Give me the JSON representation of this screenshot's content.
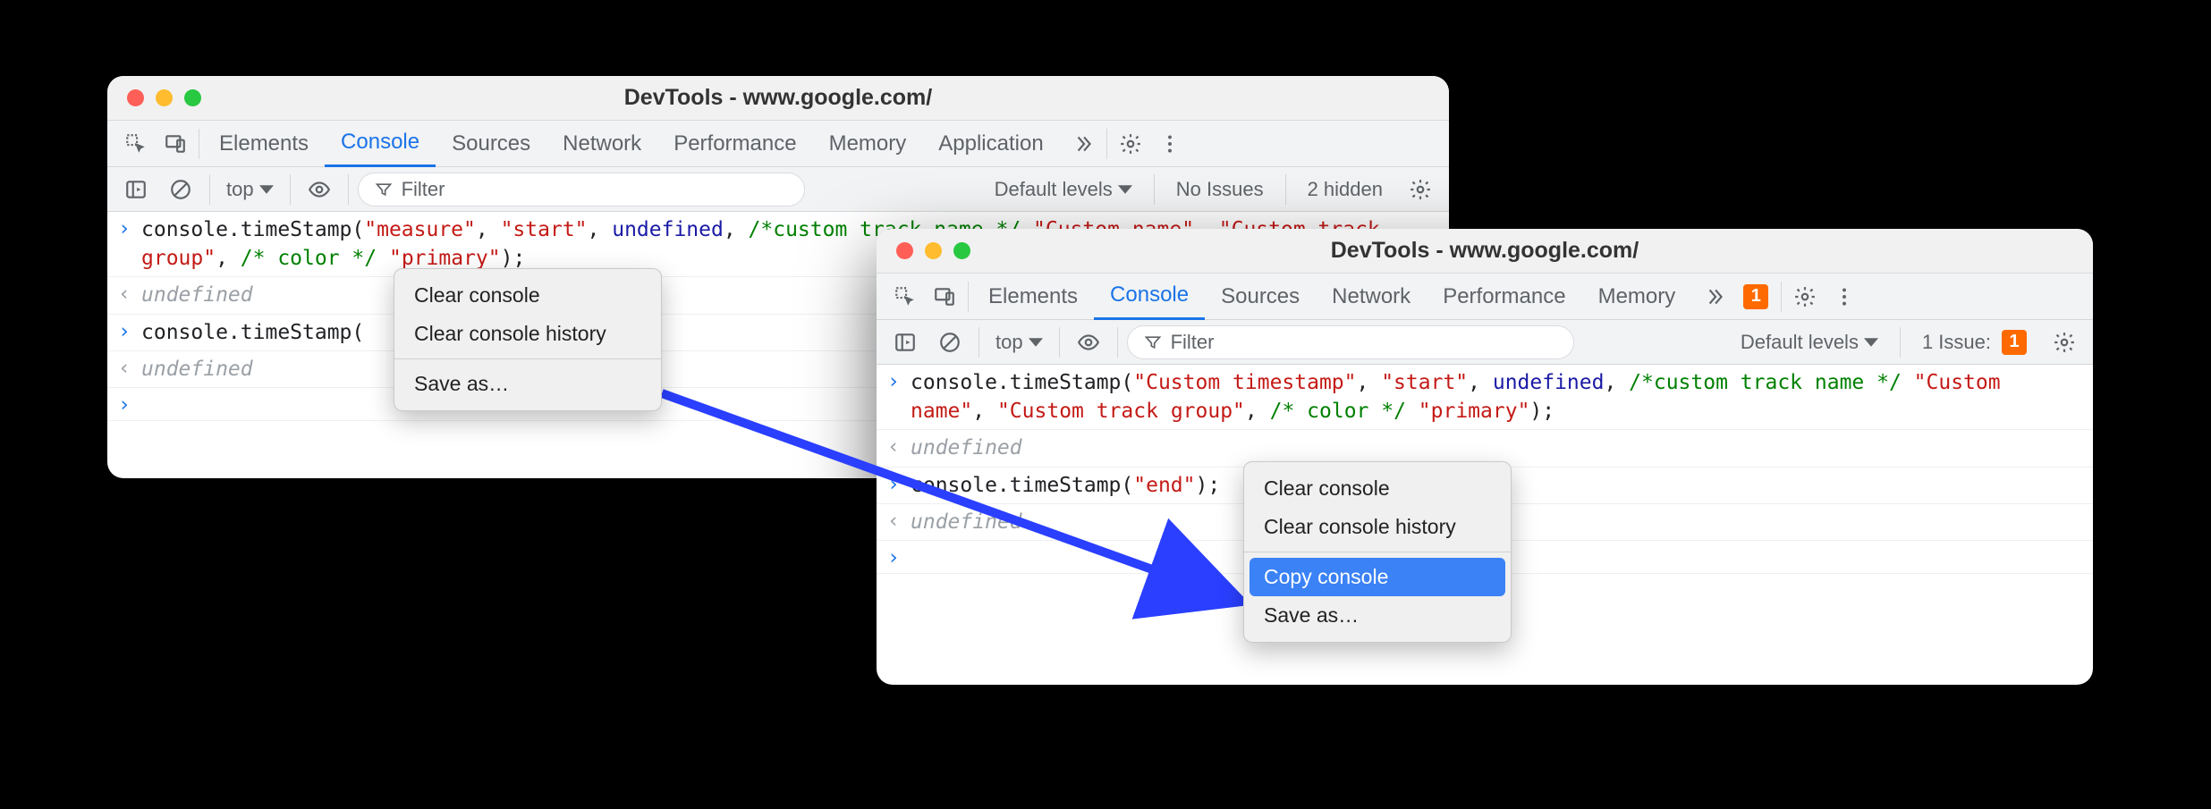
{
  "left": {
    "title": "DevTools - www.google.com/",
    "tabs": [
      "Elements",
      "Console",
      "Sources",
      "Network",
      "Performance",
      "Memory",
      "Application"
    ],
    "active_tab": "Console",
    "filter": {
      "context": "top",
      "placeholder": "Filter",
      "levels": "Default levels",
      "issues": "No Issues",
      "hidden": "2 hidden"
    },
    "console": [
      {
        "type": "input",
        "segments": [
          {
            "t": "fn",
            "v": "console.timeStamp("
          },
          {
            "t": "str",
            "v": "\"measure\""
          },
          {
            "t": "fn",
            "v": ", "
          },
          {
            "t": "str",
            "v": "\"start\""
          },
          {
            "t": "fn",
            "v": ", "
          },
          {
            "t": "kw",
            "v": "undefined"
          },
          {
            "t": "fn",
            "v": ", "
          },
          {
            "t": "cmt",
            "v": "/*custom track name */"
          },
          {
            "t": "fn",
            "v": " "
          },
          {
            "t": "str",
            "v": "\"Custom name\""
          },
          {
            "t": "fn",
            "v": ", "
          },
          {
            "t": "str",
            "v": "\"Custom track group\""
          },
          {
            "t": "fn",
            "v": ", "
          },
          {
            "t": "cmt",
            "v": "/* color */"
          },
          {
            "t": "fn",
            "v": " "
          },
          {
            "t": "str",
            "v": "\"primary\""
          },
          {
            "t": "fn",
            "v": ");"
          }
        ]
      },
      {
        "type": "output",
        "text": "undefined"
      },
      {
        "type": "input",
        "segments": [
          {
            "t": "fn",
            "v": "console.timeStamp("
          }
        ]
      },
      {
        "type": "output",
        "text": "undefined"
      },
      {
        "type": "prompt"
      }
    ],
    "menu": {
      "items": [
        "Clear console",
        "Clear console history"
      ],
      "after_sep": [
        "Save as…"
      ]
    }
  },
  "right": {
    "title": "DevTools - www.google.com/",
    "tabs": [
      "Elements",
      "Console",
      "Sources",
      "Network",
      "Performance",
      "Memory"
    ],
    "active_tab": "Console",
    "issue_badge": "1",
    "filter": {
      "context": "top",
      "placeholder": "Filter",
      "levels": "Default levels",
      "issues_label": "1 Issue:",
      "issues_count": "1"
    },
    "console": [
      {
        "type": "input",
        "segments": [
          {
            "t": "fn",
            "v": "console.timeStamp("
          },
          {
            "t": "str",
            "v": "\"Custom timestamp\""
          },
          {
            "t": "fn",
            "v": ", "
          },
          {
            "t": "str",
            "v": "\"start\""
          },
          {
            "t": "fn",
            "v": ", "
          },
          {
            "t": "kw",
            "v": "undefined"
          },
          {
            "t": "fn",
            "v": ", "
          },
          {
            "t": "cmt",
            "v": "/*custom track name */"
          },
          {
            "t": "fn",
            "v": " "
          },
          {
            "t": "str",
            "v": "\"Custom name\""
          },
          {
            "t": "fn",
            "v": ", "
          },
          {
            "t": "str",
            "v": "\"Custom track group\""
          },
          {
            "t": "fn",
            "v": ", "
          },
          {
            "t": "cmt",
            "v": "/* color */"
          },
          {
            "t": "fn",
            "v": " "
          },
          {
            "t": "str",
            "v": "\"primary\""
          },
          {
            "t": "fn",
            "v": ");"
          }
        ]
      },
      {
        "type": "output",
        "text": "undefined"
      },
      {
        "type": "input",
        "segments": [
          {
            "t": "fn",
            "v": "console.timeStamp("
          },
          {
            "t": "str",
            "v": "\"end\""
          },
          {
            "t": "fn",
            "v": ");"
          }
        ]
      },
      {
        "type": "output",
        "text": "undefined"
      },
      {
        "type": "prompt"
      }
    ],
    "menu": {
      "items": [
        "Clear console",
        "Clear console history"
      ],
      "after_sep": [
        "Copy console",
        "Save as…"
      ],
      "selected": "Copy console"
    }
  }
}
